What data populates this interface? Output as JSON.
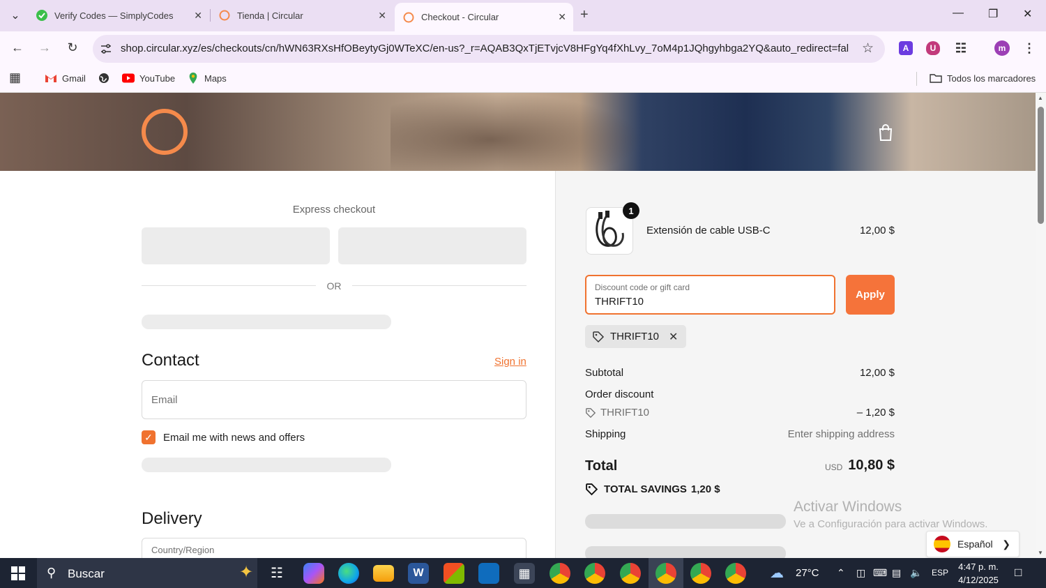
{
  "browser": {
    "tabs": [
      {
        "title": "Verify Codes — SimplyCodes",
        "active": false
      },
      {
        "title": "Tienda | Circular",
        "active": false
      },
      {
        "title": "Checkout - Circular",
        "active": true
      }
    ],
    "url": "shop.circular.xyz/es/checkouts/cn/hWN63RXsHfOBeytyGj0WTeXC/en-us?_r=AQAB3QxTjETvjcV8HFgYq4fXhLvy_7oM4p1JQhgyhbga2YQ&auto_redirect=fal...",
    "profile_initial": "m",
    "bookmarks": [
      {
        "label": "Gmail"
      },
      {
        "label": ""
      },
      {
        "label": "YouTube"
      },
      {
        "label": "Maps"
      }
    ],
    "all_bookmarks_label": "Todos los marcadores",
    "accent_color": "#ebdff3"
  },
  "checkout": {
    "express_checkout_label": "Express checkout",
    "or_label": "OR",
    "contact": {
      "title": "Contact",
      "sign_in": "Sign in",
      "email_placeholder": "Email",
      "newsletter_label": "Email me with news and offers",
      "newsletter_checked": true
    },
    "delivery": {
      "title": "Delivery",
      "country_label": "Country/Region"
    },
    "brand_color": "#f0722f"
  },
  "order_summary": {
    "item": {
      "name": "Extensión de cable USB-C",
      "price": "12,00 $",
      "quantity": "1"
    },
    "discount_field": {
      "label": "Discount code or gift card",
      "value": "THRIFT10"
    },
    "apply_label": "Apply",
    "applied_code": "THRIFT10",
    "subtotal_label": "Subtotal",
    "subtotal_value": "12,00 $",
    "order_discount_label": "Order discount",
    "order_discount_code": "THRIFT10",
    "order_discount_value": "– 1,20 $",
    "shipping_label": "Shipping",
    "shipping_value": "Enter shipping address",
    "total_label": "Total",
    "total_currency": "USD",
    "total_value": "10,80 $",
    "savings_label": "TOTAL SAVINGS",
    "savings_value": "1,20 $"
  },
  "overlay": {
    "activate_title": "Activar Windows",
    "activate_sub": "Ve a Configuración para activar Windows.",
    "language": "Español"
  },
  "taskbar": {
    "search_label": "Buscar",
    "temperature": "27°C",
    "input_lang": "ESP",
    "time": "4:47 p. m.",
    "date": "4/12/2025"
  }
}
